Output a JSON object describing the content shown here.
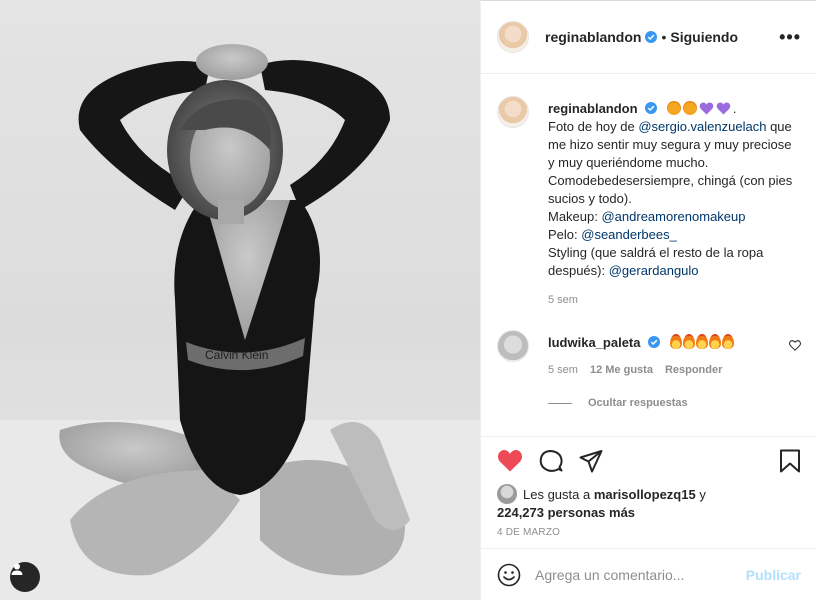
{
  "post_image": {
    "alt": "",
    "logo_text": "Calvin Klein"
  },
  "header": {
    "username": "reginablandon",
    "separator": "•",
    "follow_status": "Siguiendo",
    "more_label": "•••"
  },
  "caption": {
    "username": "reginablandon",
    "emojis": [
      "smiling-face-hearts",
      "smiling-face-hearts",
      "purple-heart",
      "purple-heart"
    ],
    "trailing": ".",
    "line1_prefix": "Foto de hoy de ",
    "mention1": "@sergio.valenzuelach",
    "line1_rest": " que me hizo sentir muy segura y muy preciose y muy queriéndome mucho. Comodebedesersiempre, chingá (con pies sucios y todo).",
    "makeup_label": "Makeup: ",
    "mention2": "@andreamorenomakeup",
    "hair_label": "Pelo: ",
    "mention3": "@seanderbees_",
    "styling_label": "Styling (que saldrá el resto de la ropa después): ",
    "mention4": "@gerardangulo",
    "time": "5 sem"
  },
  "comment": {
    "username": "ludwika_paleta",
    "emojis": [
      "fire",
      "fire",
      "fire",
      "fire",
      "fire"
    ],
    "time": "5 sem",
    "likes": "12 Me gusta",
    "reply": "Responder",
    "hide_replies": "Ocultar respuestas"
  },
  "actions": {
    "liked": true,
    "likes_prefix": "Les gusta a ",
    "liker": "marisollopezq15",
    "likes_connector": " y",
    "likes_count": "224,273 personas más",
    "date": "4 DE MARZO"
  },
  "add_comment": {
    "placeholder": "Agrega un comentario...",
    "publish": "Publicar"
  },
  "colors": {
    "like_red": "#ed4956",
    "verified_blue": "#3897f0",
    "link": "#00376b",
    "publish_disabled": "#b2dffc"
  }
}
